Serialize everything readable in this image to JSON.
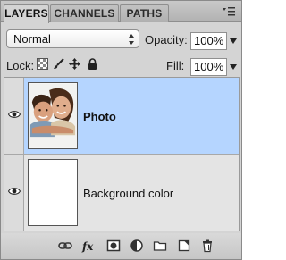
{
  "tabs": [
    {
      "label": "LAYERS"
    },
    {
      "label": "CHANNELS"
    },
    {
      "label": "PATHS"
    }
  ],
  "blend": {
    "mode": "Normal"
  },
  "opacity": {
    "label": "Opacity:",
    "value": "100%"
  },
  "lock": {
    "label": "Lock:"
  },
  "fill": {
    "label": "Fill:",
    "value": "100%"
  },
  "layers": [
    {
      "name": "Photo",
      "selected": true,
      "visible": true
    },
    {
      "name": "Background color",
      "selected": false,
      "visible": true
    }
  ],
  "toolbar_icons": [
    "link-icon",
    "fx-icon",
    "mask-icon",
    "adjustment-icon",
    "folder-icon",
    "new-layer-icon",
    "trash-icon"
  ],
  "colors": {
    "selection": "#b5d5ff",
    "panel": "#d4d4d4"
  }
}
